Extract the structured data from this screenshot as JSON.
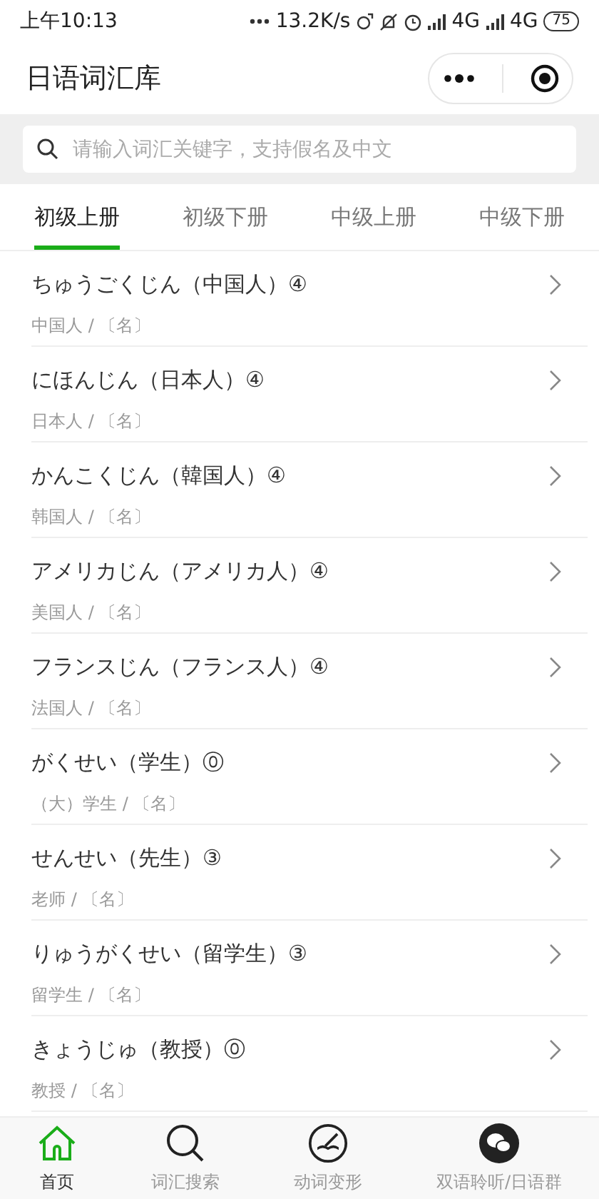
{
  "status_bar": {
    "time": "上午10:13",
    "speed": "13.2K/s",
    "network_1": "4G",
    "network_2": "4G",
    "battery": "75"
  },
  "header": {
    "title": "日语词汇库"
  },
  "search": {
    "placeholder": "请输入词汇关键字，支持假名及中文"
  },
  "tabs": [
    {
      "label": "初级上册",
      "selected": true
    },
    {
      "label": "初级下册",
      "selected": false
    },
    {
      "label": "中级上册",
      "selected": false
    },
    {
      "label": "中级下册",
      "selected": false
    }
  ],
  "words": [
    {
      "title": "ちゅうごくじん（中国人）④",
      "meaning": "中国人 / 〔名〕"
    },
    {
      "title": "にほんじん（日本人）④",
      "meaning": "日本人 / 〔名〕"
    },
    {
      "title": "かんこくじん（韓国人）④",
      "meaning": "韩国人 / 〔名〕"
    },
    {
      "title": "アメリカじん（アメリカ人）④",
      "meaning": "美国人 / 〔名〕"
    },
    {
      "title": "フランスじん（フランス人）④",
      "meaning": "法国人 / 〔名〕"
    },
    {
      "title": "がくせい（学生）⓪",
      "meaning": "（大）学生 / 〔名〕"
    },
    {
      "title": "せんせい（先生）③",
      "meaning": "老师 / 〔名〕"
    },
    {
      "title": "りゅうがくせい（留学生）③",
      "meaning": "留学生 / 〔名〕"
    },
    {
      "title": "きょうじゅ（教授）⓪",
      "meaning": "教授 / 〔名〕"
    }
  ],
  "bottom_nav": [
    {
      "label": "首页",
      "kind": "home",
      "selected": true
    },
    {
      "label": "词汇搜索",
      "kind": "search",
      "selected": false
    },
    {
      "label": "动词变形",
      "kind": "verb",
      "selected": false
    },
    {
      "label": "双语聆听/日语群",
      "kind": "chat",
      "selected": false
    }
  ]
}
